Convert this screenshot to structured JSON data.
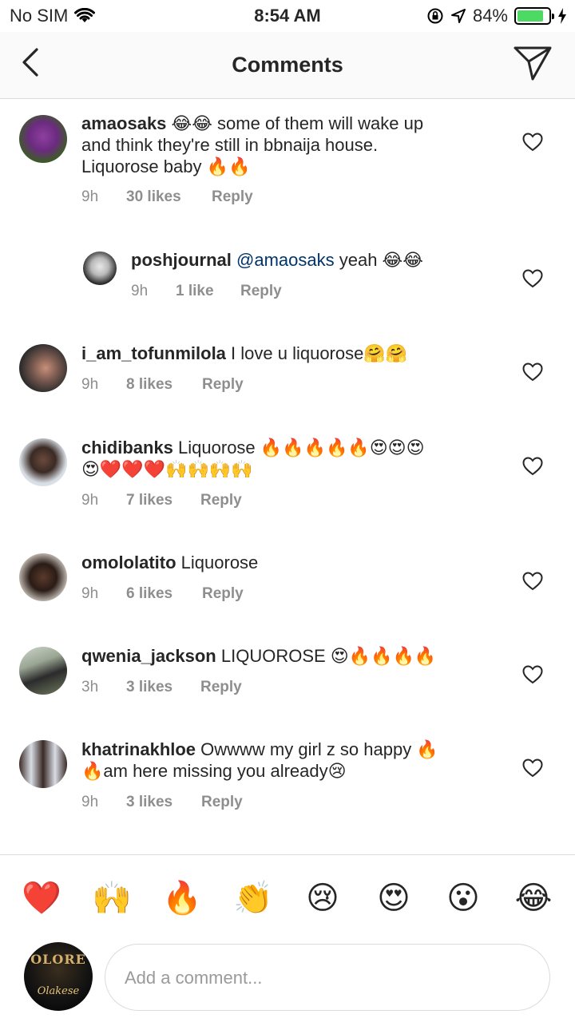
{
  "status_bar": {
    "carrier": "No SIM",
    "time": "8:54 AM",
    "battery_percent": "84%",
    "battery_level": 0.84
  },
  "nav": {
    "title": "Comments"
  },
  "comments": [
    {
      "username": "amaosaks",
      "lines": [
        " 😂😂 some of them will wake up",
        "and think they're still in bbnaija house.",
        "Liquorose baby 🔥🔥"
      ],
      "time": "9h",
      "likes": "30 likes",
      "reply": "Reply"
    },
    {
      "username": "poshjournal",
      "mention": "@amaosaks",
      "text_after": " yeah 😂😂",
      "time": "9h",
      "likes": "1 like",
      "reply": "Reply"
    },
    {
      "username": "i_am_tofunmilola",
      "lines": [
        " I love u liquorose🤗🤗"
      ],
      "time": "9h",
      "likes": "8 likes",
      "reply": "Reply"
    },
    {
      "username": "chidibanks",
      "lines": [
        " Liquorose 🔥🔥🔥🔥🔥😍😍😍",
        "😍❤️❤️❤️🙌🙌🙌🙌"
      ],
      "time": "9h",
      "likes": "7 likes",
      "reply": "Reply"
    },
    {
      "username": "omololatito",
      "lines": [
        " Liquorose"
      ],
      "time": "9h",
      "likes": "6 likes",
      "reply": "Reply"
    },
    {
      "username": "qwenia_jackson",
      "lines": [
        " LIQUOROSE 😍🔥🔥🔥🔥"
      ],
      "time": "3h",
      "likes": "3 likes",
      "reply": "Reply"
    },
    {
      "username": "khatrinakhloe",
      "lines": [
        " Owwww my girl z so happy 🔥",
        "🔥am here missing you already😢"
      ],
      "time": "9h",
      "likes": "3 likes",
      "reply": "Reply"
    }
  ],
  "emoji_bar": [
    "❤️",
    "🙌",
    "🔥",
    "👏",
    "😢",
    "😍",
    "😮",
    "😂"
  ],
  "composer": {
    "placeholder": "Add a comment...",
    "avatar_brand": "OLORE",
    "avatar_signature": "Olakese"
  },
  "colors": {
    "text": "#262626",
    "meta": "#8e8e8e",
    "mention": "#003569",
    "divider": "#dbdbdb",
    "battery": "#4cd964"
  },
  "icons": {
    "back": "chevron-left-icon",
    "send": "paper-plane-icon",
    "like": "heart-outline-icon",
    "wifi": "wifi-icon",
    "lock": "orientation-lock-icon",
    "location": "location-arrow-icon",
    "charging": "bolt-icon"
  }
}
